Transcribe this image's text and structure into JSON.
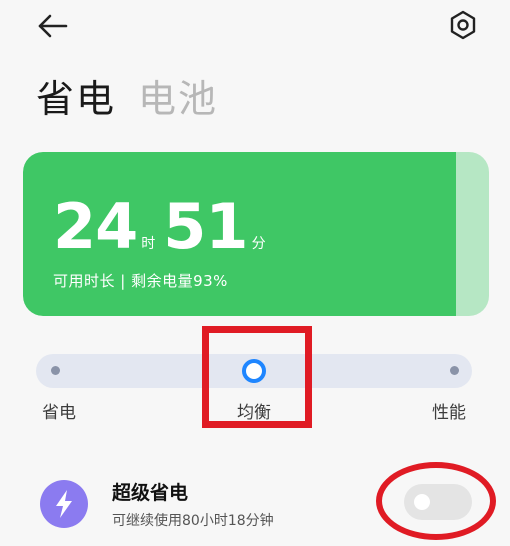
{
  "header": {
    "back_icon": "back-arrow-icon",
    "settings_icon": "gear-icon"
  },
  "tabs": [
    {
      "label": "省电",
      "active": true
    },
    {
      "label": "电池",
      "active": false
    }
  ],
  "battery_card": {
    "hours": "24",
    "hours_unit": "时",
    "minutes": "51",
    "minutes_unit": "分",
    "subtitle": "可用时长 | 剩余电量93%",
    "charge_level": 0.93,
    "fill_color": "#3fc765",
    "empty_color": "#b6e7c4"
  },
  "modes": {
    "options": [
      "省电",
      "均衡",
      "性能"
    ],
    "selected": "均衡",
    "selected_color": "#1f86ff"
  },
  "super_saver": {
    "icon": "lightning-bolt-icon",
    "title": "超级省电",
    "subtitle": "可继续使用80小时18分钟",
    "enabled": false
  },
  "annotations": {
    "color": "#e01b24"
  }
}
